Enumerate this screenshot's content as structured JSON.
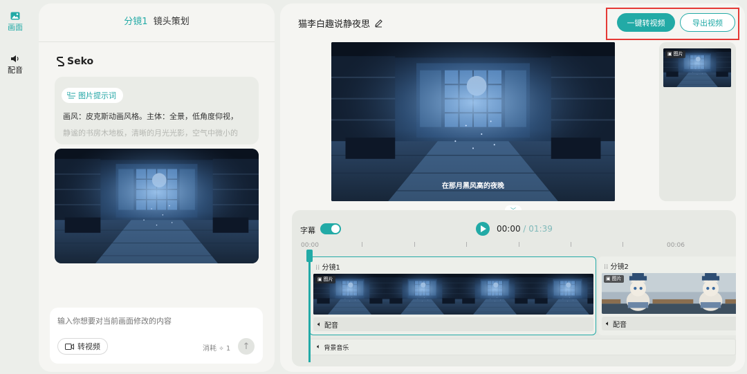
{
  "sidebar": {
    "items": [
      {
        "label": "画面",
        "icon": "image-icon",
        "active": true
      },
      {
        "label": "配音",
        "icon": "speaker-icon",
        "active": false
      }
    ]
  },
  "left_panel": {
    "header_shot": "分镜1",
    "header_title": "镜头策划",
    "brand": "Seko",
    "prompt_tag": "图片提示词",
    "prompt_line1": "画风：皮克斯动画风格。主体：全景，低角度仰视，",
    "prompt_line2": "静谧的书房木地板，清晰的月光光影，空气中微小的",
    "input_placeholder": "输入你想要对当前画面修改的内容",
    "to_video_label": "转视频",
    "cost_label": "消耗",
    "cost_value": "1"
  },
  "right_panel": {
    "project_title": "猫李白趣说静夜思",
    "btn_one_click": "一键转视频",
    "btn_export": "导出视频",
    "subtitle_text": "在那月黑风高的夜晚",
    "image_tag": "图片"
  },
  "timeline": {
    "subtitle_label": "字幕",
    "subtitle_enabled": true,
    "current_time": "00:00",
    "separator": "/",
    "total_time": "01:39",
    "ruler_start": "00:00",
    "ruler_mark": "00:06",
    "clips": [
      {
        "name": "分镜1",
        "audio_label": "配音",
        "image_tag": "图片"
      },
      {
        "name": "分镜2",
        "audio_label": "配音",
        "image_tag": "图片"
      }
    ],
    "bgm_label": "背景音乐"
  },
  "colors": {
    "accent": "#22aaa6",
    "highlight": "#e53935",
    "background": "#eceeea",
    "panel": "#f5f5f2"
  }
}
